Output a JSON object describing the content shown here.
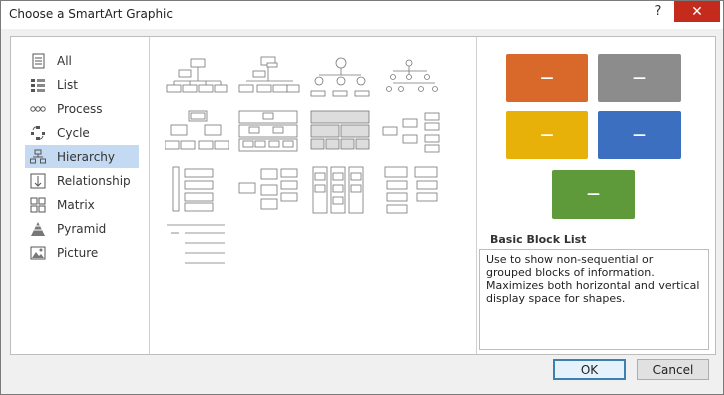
{
  "window": {
    "title": "Choose a SmartArt Graphic",
    "help_label": "?",
    "close_label": "✕"
  },
  "categories": [
    {
      "label": "All",
      "icon": "all-icon"
    },
    {
      "label": "List",
      "icon": "list-icon"
    },
    {
      "label": "Process",
      "icon": "process-icon"
    },
    {
      "label": "Cycle",
      "icon": "cycle-icon"
    },
    {
      "label": "Hierarchy",
      "icon": "hierarchy-icon",
      "selected": true
    },
    {
      "label": "Relationship",
      "icon": "relationship-icon"
    },
    {
      "label": "Matrix",
      "icon": "matrix-icon"
    },
    {
      "label": "Pyramid",
      "icon": "pyramid-icon"
    },
    {
      "label": "Picture",
      "icon": "picture-icon"
    }
  ],
  "preview": {
    "name": "Basic Block List",
    "description": "Use to show non-sequential or grouped blocks of information. Maximizes both horizontal and vertical display space for shapes.",
    "block_label": "—",
    "colors": {
      "orange": "#d9692a",
      "gray": "#8c8c8c",
      "gold": "#e8b10a",
      "blue": "#3c6fbf",
      "green": "#5f9a3a"
    }
  },
  "buttons": {
    "ok": "OK",
    "cancel": "Cancel"
  },
  "colors": {
    "selected_bg": "#c4d9f2",
    "close_bg": "#c42b1c"
  }
}
